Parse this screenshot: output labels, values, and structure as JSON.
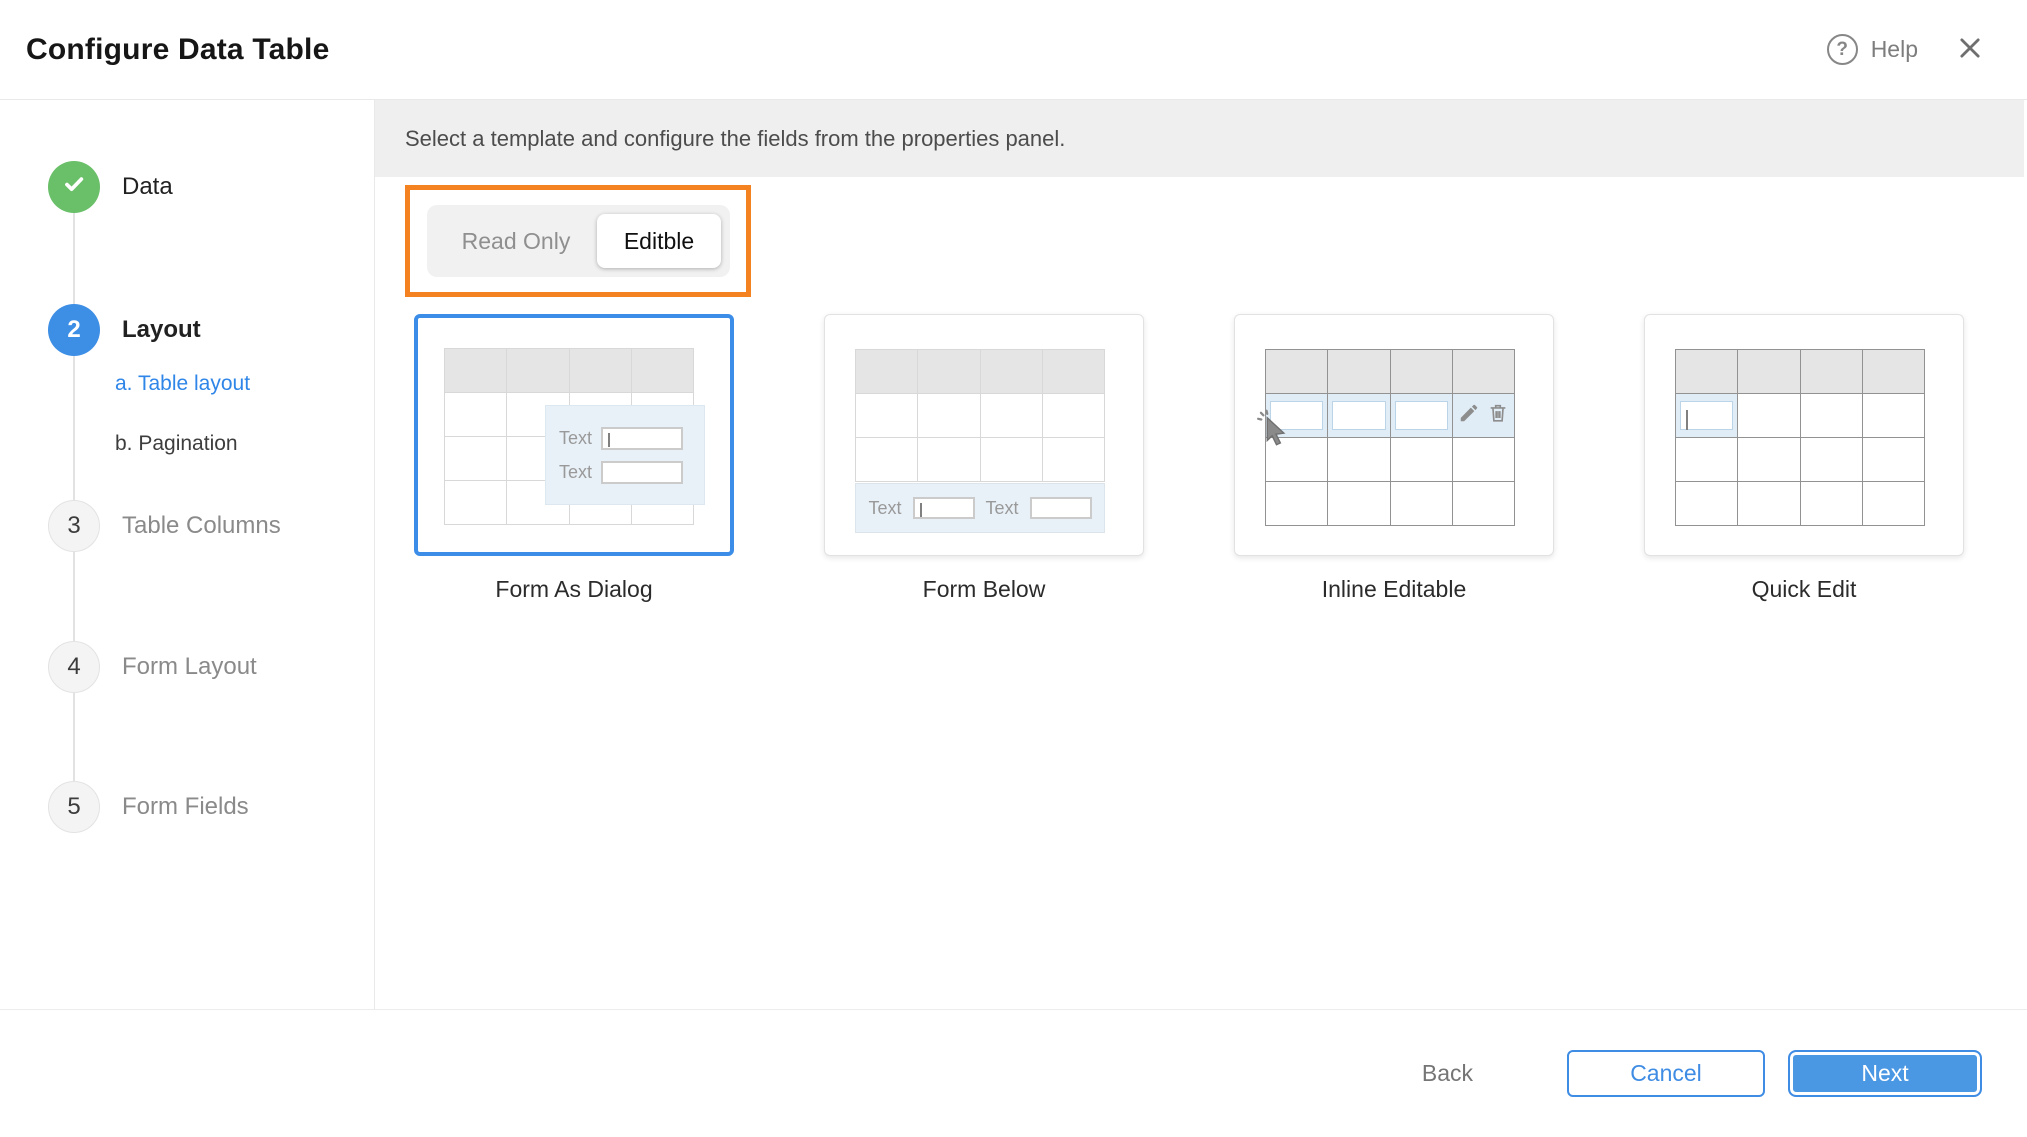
{
  "header": {
    "title": "Configure Data Table",
    "help_label": "Help",
    "help_icon": "question-circle-icon",
    "close_icon": "close-icon"
  },
  "stepper": {
    "steps": [
      {
        "label": "Data",
        "state": "complete",
        "icon": "check-icon"
      },
      {
        "label": "Layout",
        "number": "2",
        "state": "active",
        "substeps": [
          {
            "label": "a. Table layout",
            "active": true
          },
          {
            "label": "b. Pagination",
            "active": false
          }
        ]
      },
      {
        "label": "Table Columns",
        "number": "3",
        "state": "pending"
      },
      {
        "label": "Form Layout",
        "number": "4",
        "state": "pending"
      },
      {
        "label": "Form Fields",
        "number": "5",
        "state": "pending"
      }
    ]
  },
  "main": {
    "instruction": "Select a template and configure the fields from the properties panel.",
    "mode_toggle": {
      "options": [
        "Read Only",
        "Editble"
      ],
      "selected": "Editble"
    },
    "templates": [
      {
        "label": "Form As Dialog",
        "selected": true
      },
      {
        "label": "Form Below",
        "selected": false
      },
      {
        "label": "Inline Editable",
        "selected": false
      },
      {
        "label": "Quick Edit",
        "selected": false
      }
    ],
    "mockup_text_label": "Text"
  },
  "footer": {
    "back_label": "Back",
    "cancel_label": "Cancel",
    "next_label": "Next"
  },
  "colors": {
    "accent_blue": "#3f8ce4",
    "highlight_orange": "#f58220",
    "success_green": "#6abf69",
    "selected_card_border": "#3b8de8"
  }
}
